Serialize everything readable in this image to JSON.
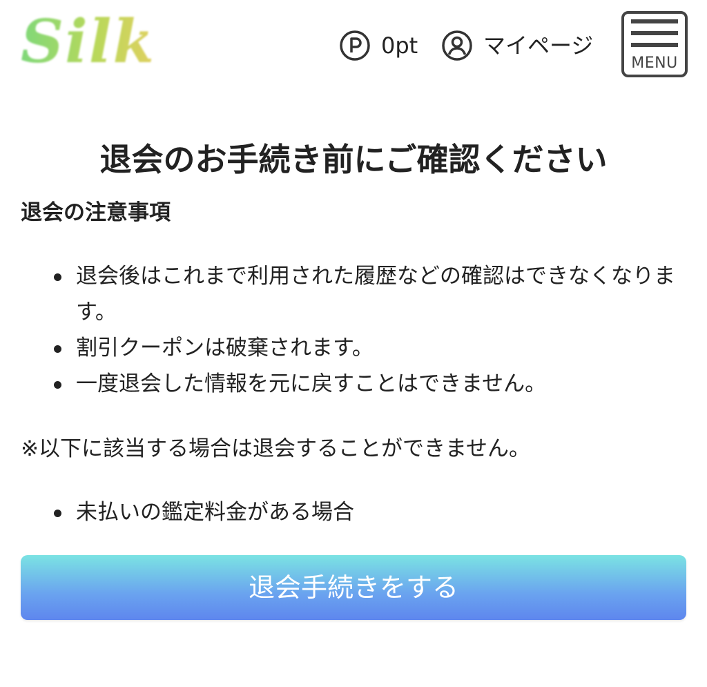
{
  "header": {
    "logo_text": "Silk",
    "points_value": "0pt",
    "mypage_label": "マイページ",
    "menu_label": "MENU"
  },
  "main": {
    "title": "退会のお手続き前にご確認ください",
    "notes_heading": "退会の注意事項",
    "notes": [
      "退会後はこれまで利用された履歴などの確認はできなくなります。",
      "割引クーポンは破棄されます。",
      "一度退会した情報を元に戻すことはできません。"
    ],
    "conditions_note": "※以下に該当する場合は退会することができません。",
    "conditions": [
      "未払いの鑑定料金がある場合"
    ],
    "withdraw_button_label": "退会手続きをする"
  },
  "icons": {
    "points": "points-p-icon",
    "mypage": "user-circle-icon",
    "menu": "hamburger-menu-icon"
  },
  "colors": {
    "button_gradient_top": "#7be3e3",
    "button_gradient_bottom": "#5e86ee",
    "logo_green": "#7fd87a",
    "logo_yellow": "#e0d060",
    "text": "#222222",
    "icon_gray": "#444444"
  }
}
